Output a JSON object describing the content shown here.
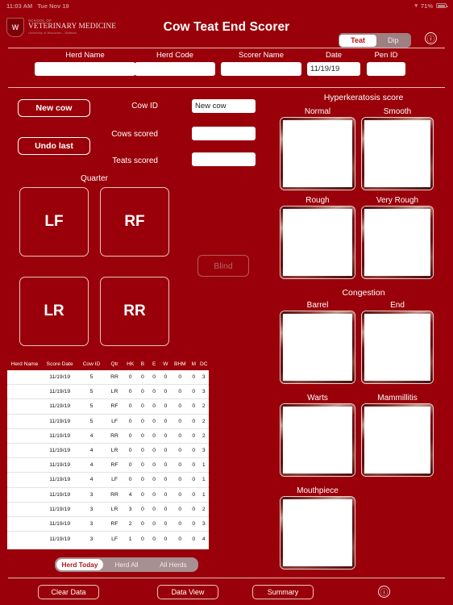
{
  "status_bar": {
    "time": "11:03 AM",
    "date": "Tue Nov 19",
    "wifi_icon": "wifi-icon",
    "battery_percent": "71%",
    "battery_icon": "battery-icon"
  },
  "header": {
    "logo": {
      "crest": "W",
      "line1": "SCHOOL OF",
      "line2": "VETERINARY MEDICINE",
      "line3": "University of Wisconsin - Madison"
    },
    "title": "Cow Teat End Scorer",
    "mode_toggle": {
      "options": [
        "Teat",
        "Dip"
      ],
      "selected": "Teat"
    },
    "info_icon": "info-icon",
    "info_glyph": "ⓘ"
  },
  "form": {
    "fields": [
      {
        "label": "Herd Name",
        "value": "",
        "placeholder": ""
      },
      {
        "label": "Herd Code",
        "value": "",
        "placeholder": ""
      },
      {
        "label": "Scorer Name",
        "value": "",
        "placeholder": ""
      },
      {
        "label": "Date",
        "value": "11/19/19",
        "placeholder": ""
      },
      {
        "label": "Pen ID",
        "value": "",
        "placeholder": ""
      }
    ]
  },
  "left_panel": {
    "new_cow_button": "New cow",
    "undo_last_button": "Undo last",
    "cow_id_label": "Cow ID",
    "cow_id_value": "New cow",
    "cows_scored_label": "Cows scored",
    "cows_scored_value": "",
    "teats_scored_label": "Teats scored",
    "teats_scored_value": "",
    "quarter_title": "Quarter",
    "quarters": [
      "LF",
      "RF",
      "LR",
      "RR"
    ],
    "blind_button": "Blind"
  },
  "right_panel": {
    "hyperkeratosis": {
      "title": "Hyperkeratosis score",
      "slots": [
        "Normal",
        "Smooth",
        "Rough",
        "Very Rough"
      ]
    },
    "congestion": {
      "title": "Congestion",
      "slots": [
        "Barrel",
        "End",
        "Warts",
        "Mammillitis"
      ]
    },
    "mouthpiece": {
      "title": "Mouthpiece",
      "slots": [
        "Mouthpiece"
      ]
    }
  },
  "table": {
    "columns": [
      "Herd Name",
      "Score Date",
      "Cow ID",
      "Qtr",
      "HK",
      "B",
      "E",
      "W",
      "BHM",
      "M",
      "DC"
    ],
    "rows": [
      [
        "",
        "11/19/19",
        "5",
        "RR",
        "0",
        "0",
        "0",
        "0",
        "0",
        "0",
        "3"
      ],
      [
        "",
        "11/19/19",
        "5",
        "LR",
        "0",
        "0",
        "0",
        "0",
        "0",
        "0",
        "3"
      ],
      [
        "",
        "11/19/19",
        "5",
        "RF",
        "0",
        "0",
        "0",
        "0",
        "0",
        "0",
        "2"
      ],
      [
        "",
        "11/19/19",
        "5",
        "LF",
        "0",
        "0",
        "0",
        "0",
        "0",
        "0",
        "2"
      ],
      [
        "",
        "11/19/19",
        "4",
        "RR",
        "0",
        "0",
        "0",
        "0",
        "0",
        "0",
        "2"
      ],
      [
        "",
        "11/19/19",
        "4",
        "LR",
        "0",
        "0",
        "0",
        "0",
        "0",
        "0",
        "3"
      ],
      [
        "",
        "11/19/19",
        "4",
        "RF",
        "0",
        "0",
        "0",
        "0",
        "0",
        "0",
        "1"
      ],
      [
        "",
        "11/19/19",
        "4",
        "LF",
        "0",
        "0",
        "0",
        "0",
        "0",
        "0",
        "1"
      ],
      [
        "",
        "11/19/19",
        "3",
        "RR",
        "4",
        "0",
        "0",
        "0",
        "0",
        "0",
        "1"
      ],
      [
        "",
        "11/19/19",
        "3",
        "LR",
        "3",
        "0",
        "0",
        "0",
        "0",
        "0",
        "2"
      ],
      [
        "",
        "11/19/19",
        "3",
        "RF",
        "2",
        "0",
        "0",
        "0",
        "0",
        "0",
        "3"
      ],
      [
        "",
        "11/19/19",
        "3",
        "LF",
        "1",
        "0",
        "0",
        "0",
        "0",
        "0",
        "4"
      ]
    ],
    "scope_toggle": {
      "options": [
        "Herd Today",
        "Herd All",
        "All Herds"
      ],
      "selected": "Herd Today"
    }
  },
  "bottom_bar": {
    "buttons": [
      "Clear Data",
      "Data View",
      "Summary"
    ],
    "info_icon": "info-icon",
    "info_glyph": "ⓘ"
  },
  "colors": {
    "background": "#9a0009",
    "accent_white": "#ffffff",
    "toggle_text": "#b3151c",
    "muted_border": "#b45b60"
  }
}
